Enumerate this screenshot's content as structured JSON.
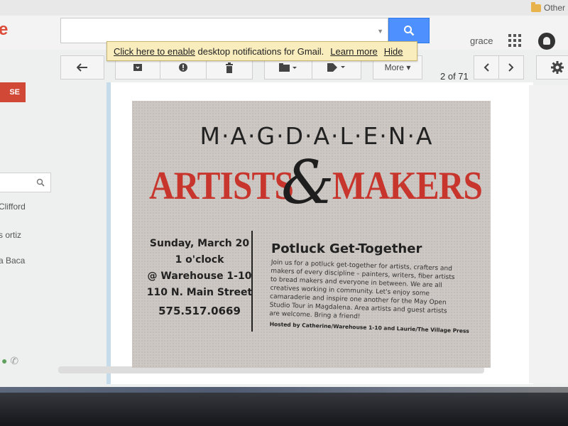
{
  "browser": {
    "bookmark_label": "Other"
  },
  "header": {
    "logo_text": "e",
    "search_placeholder": "",
    "user_name": "grace"
  },
  "banner": {
    "part1": "Click here to ",
    "part2": "enable",
    "part3": " desktop notifications for Gmail.",
    "learn_more": "Learn more",
    "hide": "Hide"
  },
  "toolbar": {
    "more_label": "More ▾",
    "pager": "2 of 71"
  },
  "sidebar": {
    "compose_label": "SE",
    "contacts": [
      "Clifford",
      "s ortiz",
      "a Baca"
    ]
  },
  "message": {
    "title": "M·A·G·D·A·L·E·N·A",
    "artists": "ARTISTS",
    "amp": "&",
    "makers": "MAKERS",
    "date": "Sunday, March 20",
    "time": "1 o'clock",
    "location": "@ Warehouse 1-10",
    "address": "110 N. Main Street",
    "phone": "575.517.0669",
    "heading": "Potluck Get-Together",
    "body": "Join us for a potluck get-together for artists, crafters and makers of every discipline – painters, writers, fiber artists to bread makers and everyone in between. We are all creatives working in community. Let's enjoy some camaraderie and inspire one another for the May Open Studio Tour in Magdalena. Area artists and guest artists are welcome. Bring a friend!",
    "hosted": "Hosted by Catherine/Warehouse 1-10 and Laurie/The Village Press"
  }
}
